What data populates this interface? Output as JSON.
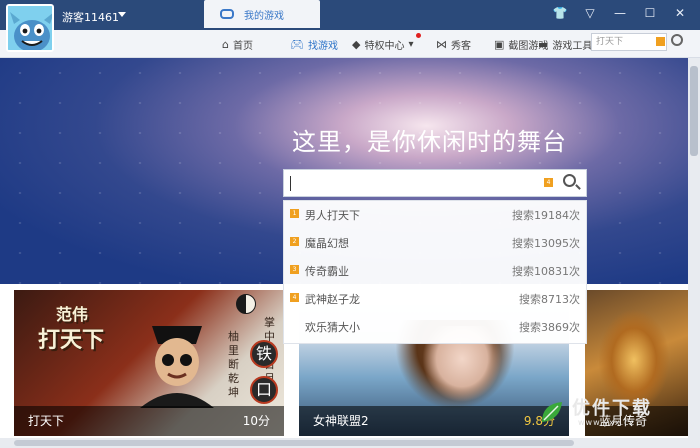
{
  "user": {
    "name": "游客11461"
  },
  "tabs": {
    "active_label": "我的游戏"
  },
  "window_controls": {
    "skin": "👕",
    "menu": "▽",
    "minimize": "—",
    "maximize": "☐",
    "close": "✕"
  },
  "nav": {
    "items": [
      {
        "label": "首页",
        "icon": "home-icon"
      },
      {
        "label": "找游戏",
        "icon": "gamepad-icon"
      },
      {
        "label": "特权中心",
        "icon": "diamond-icon"
      },
      {
        "label": "秀客",
        "icon": "ns-icon"
      },
      {
        "label": "截图游戏",
        "icon": "screenshot-icon"
      },
      {
        "label": "游戏工具",
        "icon": "toolbox-icon"
      }
    ],
    "search_placeholder": "打天下"
  },
  "hero": {
    "title": "这里，是你休闲时的舞台"
  },
  "search": {
    "value": "",
    "badge": "4",
    "suggestions": [
      {
        "rank": "1",
        "name": "男人打天下",
        "count": "搜索19184次"
      },
      {
        "rank": "2",
        "name": "魔晶幻想",
        "count": "搜索13095次"
      },
      {
        "rank": "3",
        "name": "传奇霸业",
        "count": "搜索10831次"
      },
      {
        "rank": "4",
        "name": "武神赵子龙",
        "count": "搜索8713次"
      },
      {
        "rank": "",
        "name": "欢乐猜大小",
        "count": "搜索3869次"
      }
    ]
  },
  "cards": [
    {
      "name": "打天下",
      "score": "10分",
      "art_top": "范伟",
      "art_main": "打天下",
      "art_seal": "铁",
      "art_seal2": "口"
    },
    {
      "name": "女神联盟2",
      "score": "9.8分"
    },
    {
      "name": "蓝月传奇"
    }
  ],
  "card1_vertical": {
    "col1": "柚里断乾坤",
    "col2": "掌中有日月"
  },
  "watermark": {
    "text": "优件下载",
    "sub": "www.yxx.cc"
  },
  "colors": {
    "accent": "#2f74c8",
    "badge": "#f0a020",
    "titlebar": "#2b4a7a"
  }
}
